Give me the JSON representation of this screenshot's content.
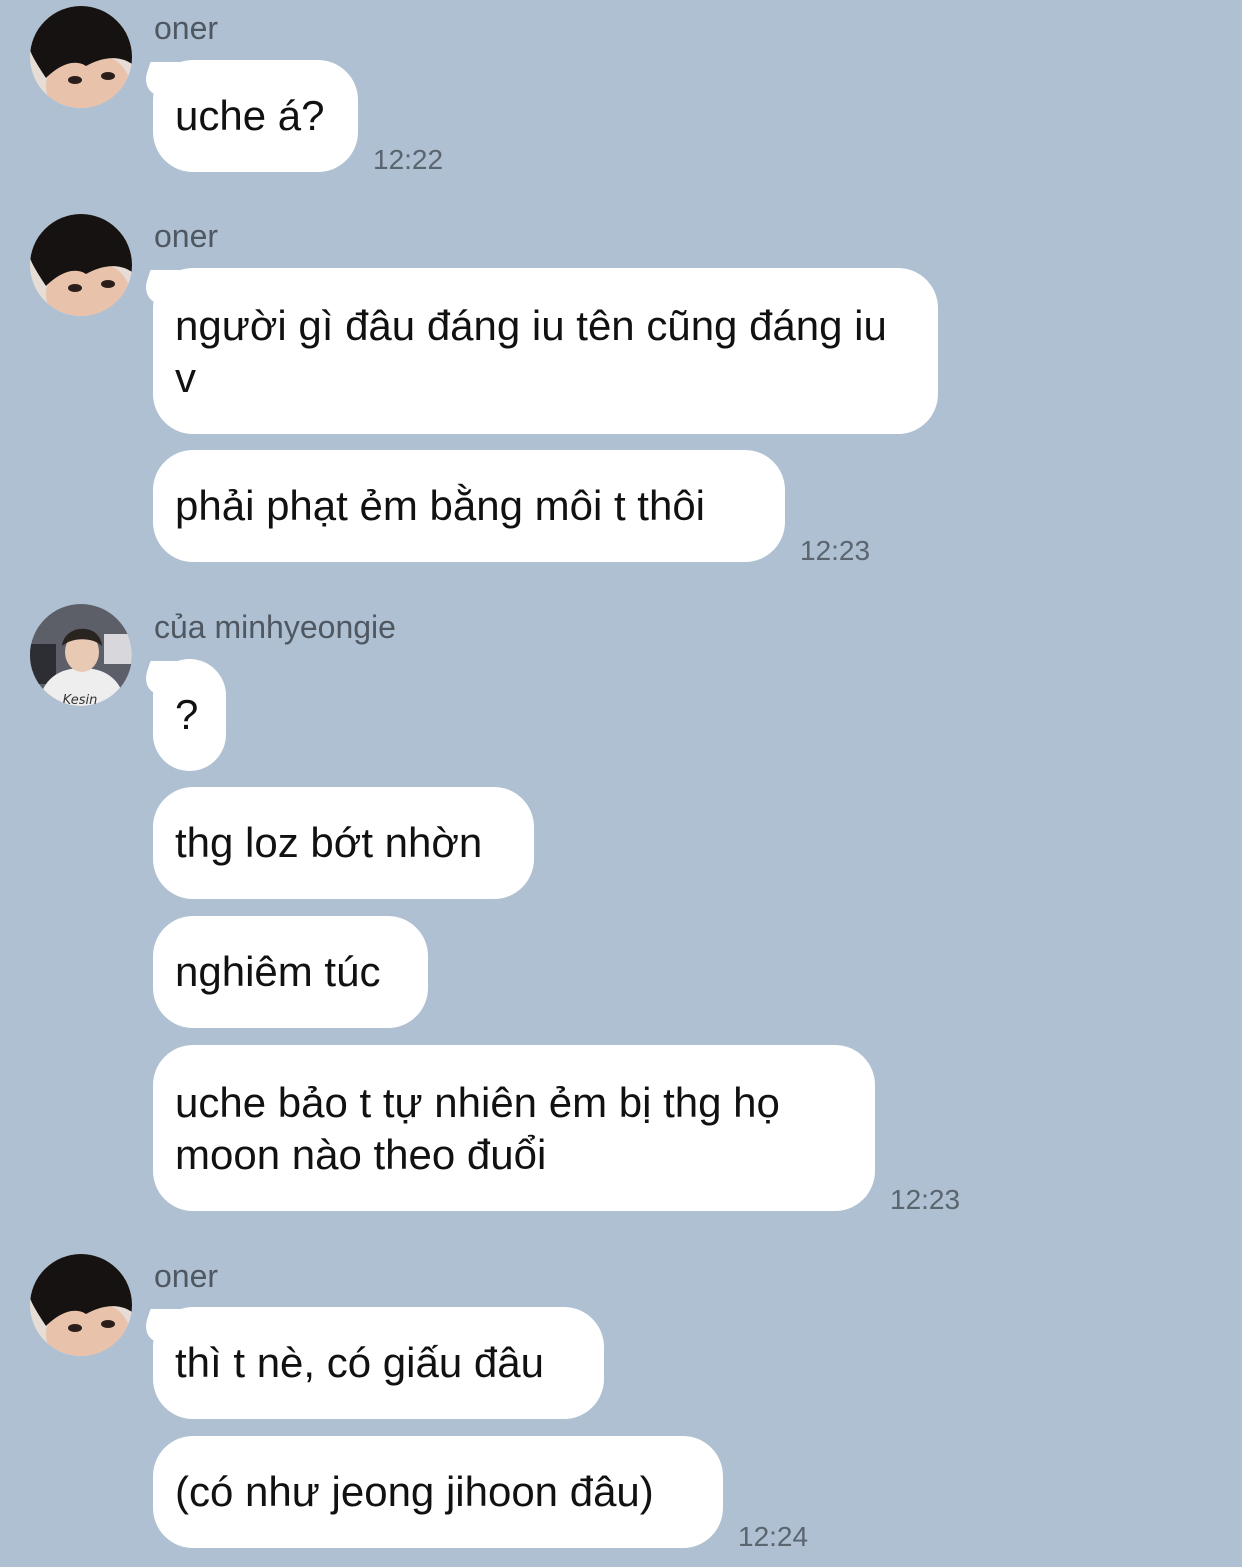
{
  "chat": {
    "groups": [
      {
        "sender": "oner",
        "avatar_icon": "oner-avatar-icon",
        "messages": [
          "uche á?"
        ],
        "time": "12:22"
      },
      {
        "sender": "oner",
        "avatar_icon": "oner-avatar-icon",
        "messages": [
          "người gì đâu đáng iu tên cũng đáng iu v",
          "phải phạt ẻm bằng môi t thôi"
        ],
        "time": "12:23"
      },
      {
        "sender": "của minhyeongie",
        "avatar_icon": "minhyeongie-avatar-icon",
        "messages": [
          "?",
          "thg loz bớt nhờn",
          "nghiêm túc",
          "uche bảo t tự nhiên ẻm bị thg họ moon nào theo đuổi"
        ],
        "time": "12:23"
      },
      {
        "sender": "oner",
        "avatar_icon": "oner-avatar-icon",
        "messages": [
          "thì t nè, có giấu đâu",
          "(có như jeong jihoon đâu)"
        ],
        "time": "12:24"
      }
    ]
  }
}
